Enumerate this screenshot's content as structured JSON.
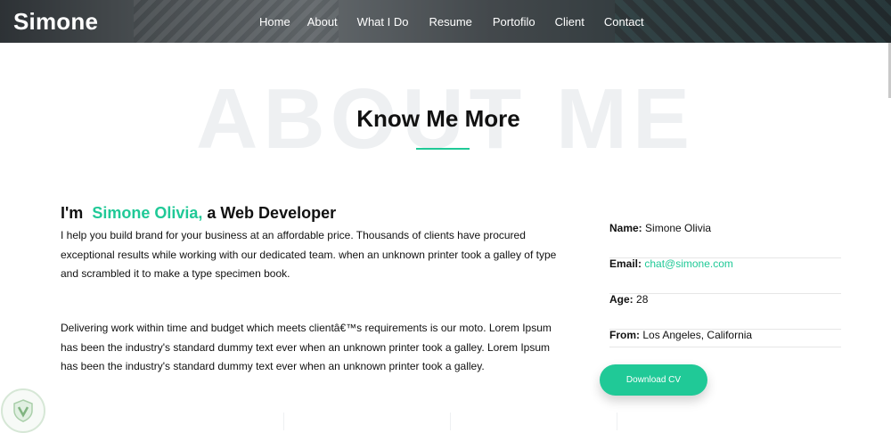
{
  "header": {
    "brand": "Simone",
    "nav": [
      "Home",
      "About",
      "What I Do",
      "Resume",
      "Portofilo",
      "Client",
      "Contact"
    ]
  },
  "section": {
    "bg_title": "ABOUT ME",
    "title": "Know Me More"
  },
  "intro": {
    "prefix": "I'm",
    "name": "Simone Olivia,",
    "suffix": "a Web Developer",
    "paragraphs": [
      "I help you build brand for your business at an affordable price. Thousands of clients have procured exceptional results while working with our dedicated team. when an unknown printer took a galley of type and scrambled it to make a type specimen book.",
      "Delivering work within time and budget which meets clientâ€™s requirements is our moto. Lorem Ipsum has been the industry's standard dummy text ever when an unknown printer took a galley. Lorem Ipsum has been the industry's standard dummy text ever when an unknown printer took a galley."
    ]
  },
  "info": {
    "name_label": "Name:",
    "name_value": "Simone Olivia",
    "email_label": "Email:",
    "email_value": "chat@simone.com",
    "age_label": "Age:",
    "age_value": "28",
    "from_label": "From:",
    "from_value": "Los Angeles, California"
  },
  "download_label": "Download CV",
  "colors": {
    "accent": "#20c997",
    "bg_title": "#eef0f2"
  },
  "icons": {
    "badge": "shield-logo-icon"
  }
}
